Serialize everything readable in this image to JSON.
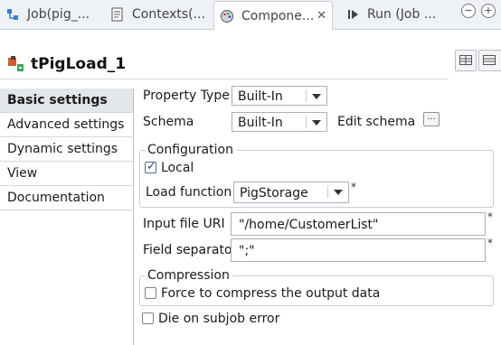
{
  "tabs": [
    {
      "label": "Job(pig_...",
      "icon": "job-icon"
    },
    {
      "label": "Contexts(...",
      "icon": "contexts-icon"
    },
    {
      "label": "Compone...",
      "icon": "component-palette-icon",
      "active": true
    },
    {
      "label": "Run (Job ...",
      "icon": "run-icon"
    }
  ],
  "window_controls": {
    "minimize": "−",
    "maximize": "+"
  },
  "header": {
    "title": "tPigLoad_1"
  },
  "sidebar": {
    "items": [
      {
        "label": "Basic settings",
        "selected": true
      },
      {
        "label": "Advanced settings"
      },
      {
        "label": "Dynamic settings"
      },
      {
        "label": "View"
      },
      {
        "label": "Documentation"
      }
    ]
  },
  "form": {
    "property_type": {
      "label": "Property Type",
      "value": "Built-In"
    },
    "schema": {
      "label": "Schema",
      "value": "Built-In",
      "edit_label": "Edit schema",
      "edit_button": "..."
    },
    "configuration": {
      "title": "Configuration",
      "local": {
        "label": "Local",
        "checked": true
      },
      "load_function": {
        "label": "Load function",
        "value": "PigStorage",
        "required": "*"
      }
    },
    "input_file_uri": {
      "label": "Input file URI",
      "value": "\"/home/CustomerList\"",
      "required": "*"
    },
    "field_separator": {
      "label": "Field separator",
      "value": "\";\"",
      "required": "*"
    },
    "compression": {
      "title": "Compression",
      "force_compress": {
        "label": "Force to compress the output data",
        "checked": false
      }
    },
    "die_on_error": {
      "label": "Die on subjob error",
      "checked": false
    }
  },
  "colors": {
    "accent": "#2a4f8a",
    "tabbar": "#eef1f6",
    "selected_item": "#e3e6ea"
  }
}
